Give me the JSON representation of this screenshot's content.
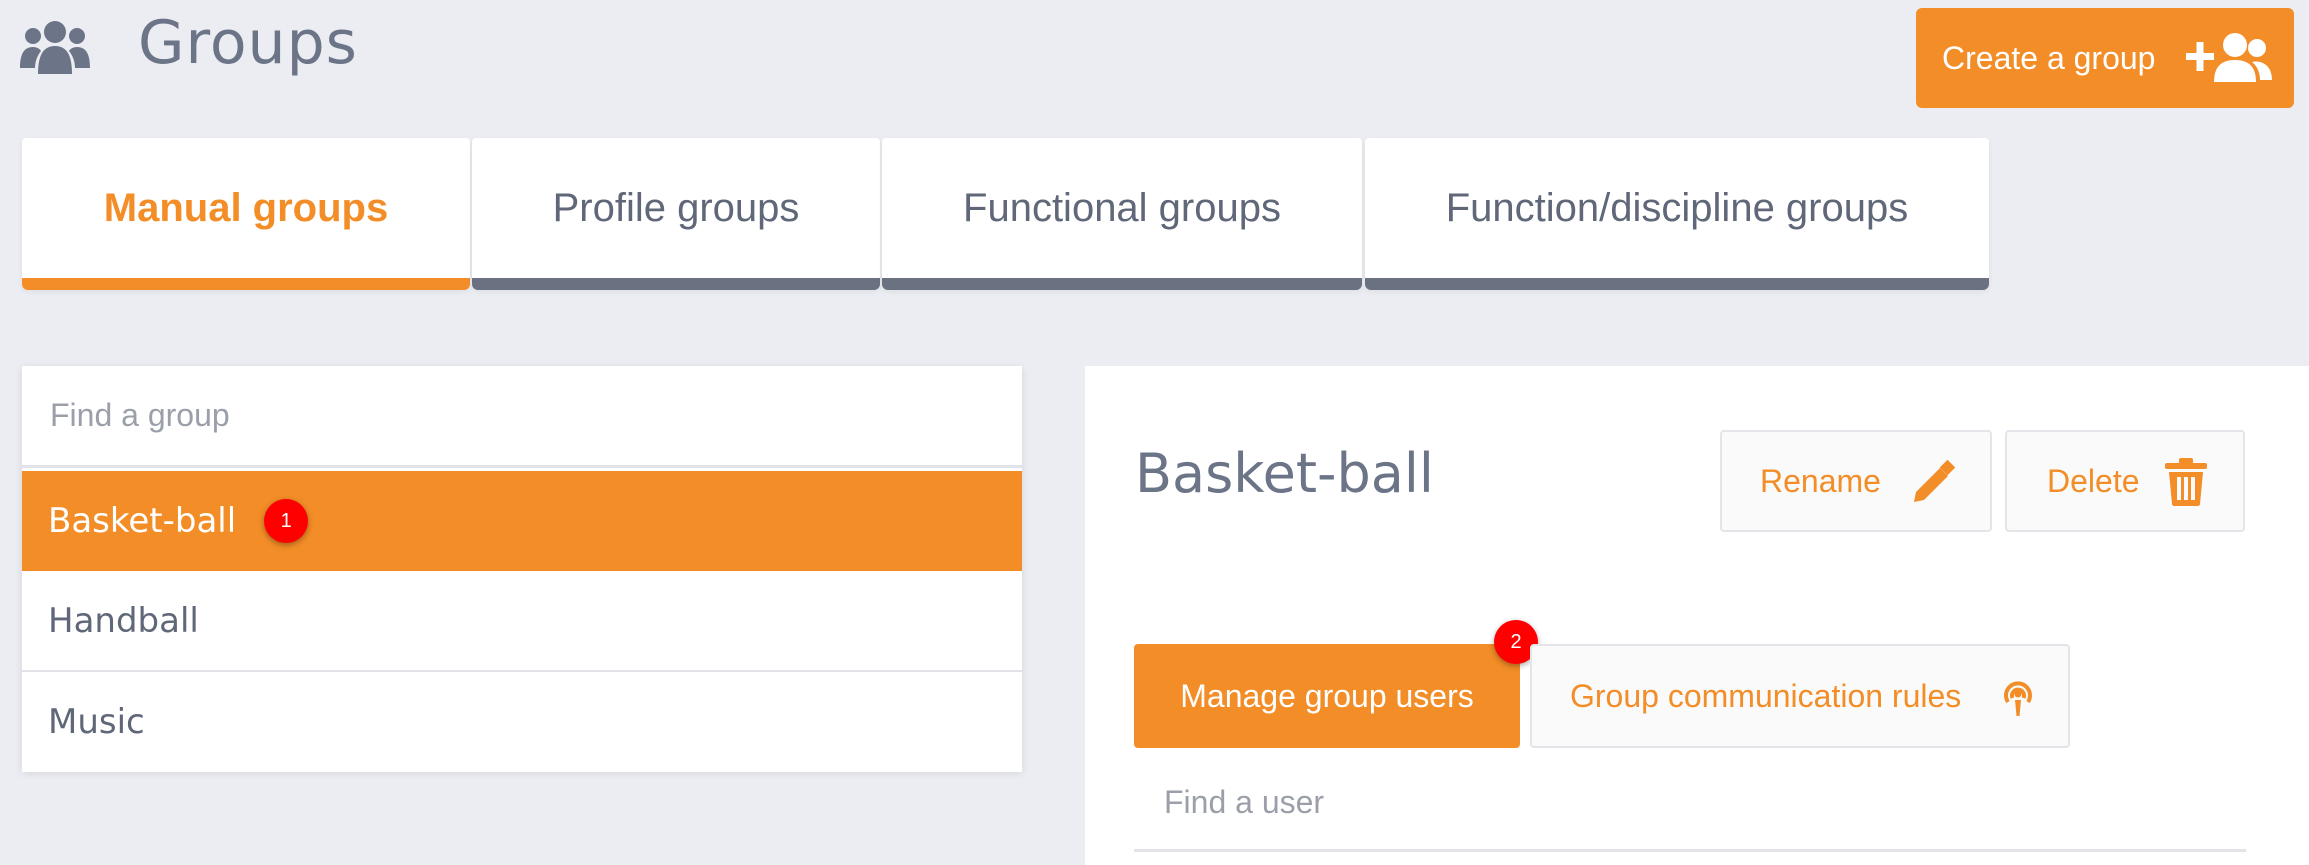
{
  "header": {
    "title": "Groups",
    "title_icon": "users-icon",
    "create_button_label": "Create a group",
    "create_button_icon": "user-plus-icon"
  },
  "tabs": [
    {
      "label": "Manual groups",
      "active": true
    },
    {
      "label": "Profile groups",
      "active": false
    },
    {
      "label": "Functional groups",
      "active": false
    },
    {
      "label": "Function/discipline groups",
      "active": false
    }
  ],
  "group_list": {
    "search_placeholder": "Find a group",
    "items": [
      {
        "label": "Basket-ball",
        "selected": true
      },
      {
        "label": "Handball",
        "selected": false
      },
      {
        "label": "Music",
        "selected": false
      }
    ]
  },
  "annotations": {
    "badge_1": "1",
    "badge_2": "2"
  },
  "detail": {
    "title": "Basket-ball",
    "rename_label": "Rename",
    "rename_icon": "pencil-icon",
    "delete_label": "Delete",
    "delete_icon": "trash-icon",
    "subtabs": [
      {
        "label": "Manage group users",
        "active": true
      },
      {
        "label": "Group communication rules",
        "active": false,
        "icon": "broadcast-icon"
      }
    ],
    "user_search_placeholder": "Find a user"
  },
  "colors": {
    "accent": "#f28d27",
    "background": "#ebedf2",
    "text": "#6a7283",
    "badge": "#ff0000",
    "tab_inactive_border": "#6a7282"
  }
}
